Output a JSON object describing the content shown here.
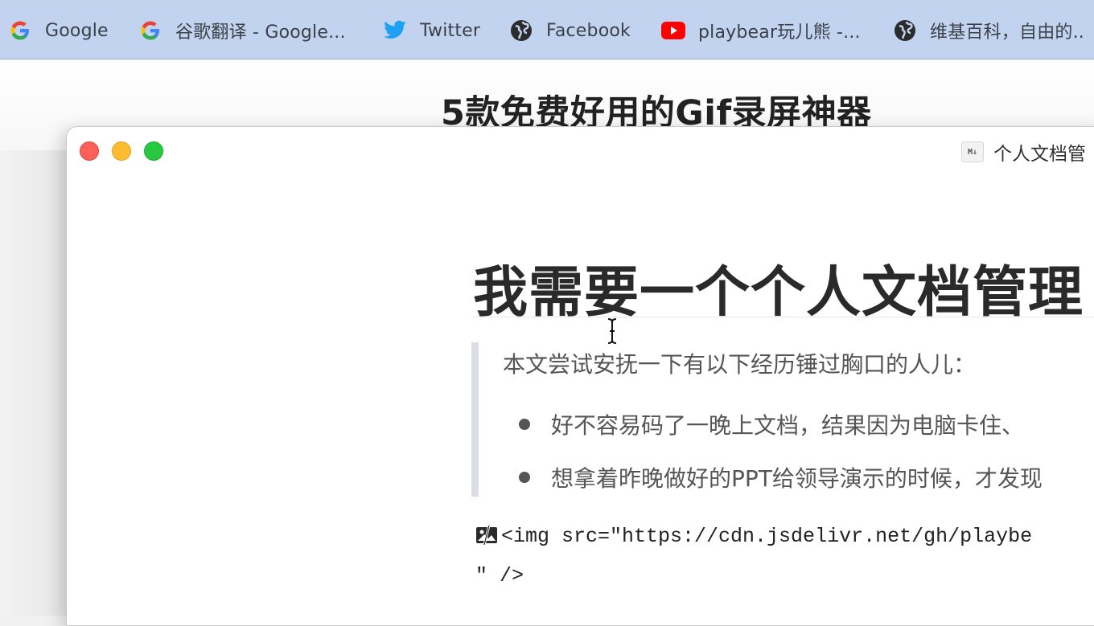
{
  "bookmarks": [
    {
      "label": "Google",
      "icon": "google-icon"
    },
    {
      "label": "谷歌翻译 - Google...",
      "icon": "google-icon"
    },
    {
      "label": "Twitter",
      "icon": "twitter-icon"
    },
    {
      "label": "Facebook",
      "icon": "globe-icon"
    },
    {
      "label": "playbear玩儿熊 -...",
      "icon": "youtube-icon"
    },
    {
      "label": "维基百科，自由的..",
      "icon": "globe-icon"
    }
  ],
  "background_page": {
    "title": "5款免费好用的Gif录屏神器"
  },
  "window": {
    "title": "个人文档管",
    "doc_icon_text": "M↓"
  },
  "document": {
    "heading": "我需要一个个人文档管理",
    "blockquote": {
      "intro": "本文尝试安抚一下有以下经历锤过胸口的人儿：",
      "items": [
        "好不容易码了一晚上文档，结果因为电脑卡住、",
        "想拿着昨晚做好的PPT给领导演示的时候，才发现"
      ]
    },
    "code_line_1": "<img src=\"https://cdn.jsdelivr.net/gh/playbe",
    "code_line_2": "\" />"
  },
  "colors": {
    "bookmark_bar": "#c2d3f0",
    "traffic_red": "#fe5f57",
    "traffic_yellow": "#febc2e",
    "traffic_green": "#28c840"
  }
}
